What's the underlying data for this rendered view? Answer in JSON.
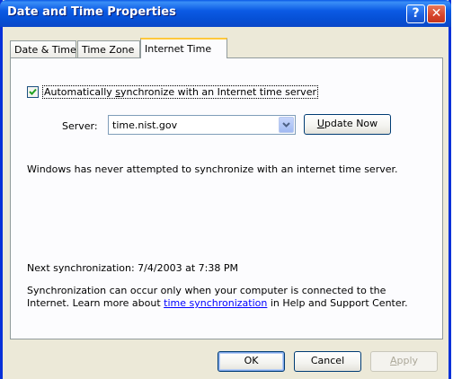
{
  "window": {
    "title": "Date and Time Properties",
    "help_glyph": "?",
    "close_glyph": "✕"
  },
  "tabs": [
    {
      "label": "Date & Time"
    },
    {
      "label": "Time Zone"
    },
    {
      "label": "Internet Time",
      "active": true
    }
  ],
  "sync": {
    "checked": true,
    "label_pre": "Automatically ",
    "label_accel": "s",
    "label_post": "ynchronize with an Internet time server"
  },
  "server": {
    "label": "Server:",
    "value": "time.nist.gov",
    "update_pre": "",
    "update_accel": "U",
    "update_post": "pdate Now"
  },
  "status_message": "Windows has never attempted to synchronize with an internet time server.",
  "next_sync": "Next synchronization: 7/4/2003 at 7:38 PM",
  "info": {
    "pre": "Synchronization can occur only when your computer is connected to the Internet.  Learn more about ",
    "link": "time synchronization",
    "post": " in Help and Support Center."
  },
  "buttons": {
    "ok": "OK",
    "cancel": "Cancel",
    "apply_accel": "A",
    "apply_post": "pply"
  }
}
